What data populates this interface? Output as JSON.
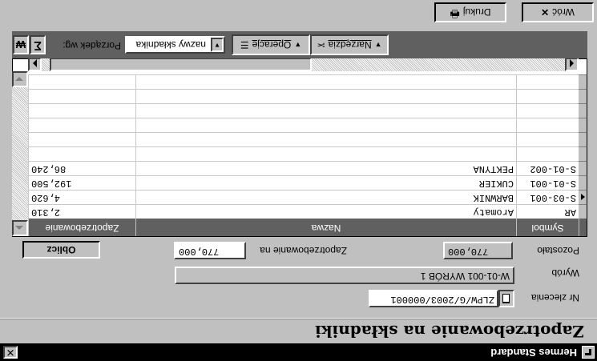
{
  "window": {
    "title": "Hermes Standard",
    "heading": "Zapotrzebowanie na składniki"
  },
  "form": {
    "order_label": "Nr zlecenia",
    "order_value": "ZLPW/G/2003/000001",
    "product_label": "Wyrób",
    "product_value": "W-01-001 WYRÓB 1",
    "remaining_label": "Pozostało",
    "remaining_value": "770,000",
    "demand_label": "Zapotrzebowanie na",
    "demand_value": "770,000",
    "calc_button": "Oblicz"
  },
  "table": {
    "columns": [
      "Symbol",
      "Nazwa",
      "Zapotrzebowanie"
    ],
    "rows": [
      {
        "symbol": "AR",
        "name": "Aromaty",
        "qty": "2,310"
      },
      {
        "symbol": "S-03-001",
        "name": "BARWNIK",
        "qty": "4,620"
      },
      {
        "symbol": "S-01-001",
        "name": "CUKIER",
        "qty": "192,500"
      },
      {
        "symbol": "S-01-002",
        "name": "PEKTYNA",
        "qty": "86,240"
      }
    ]
  },
  "toolbar": {
    "sort_label": "Porządek wg:",
    "sort_value": "nazwy składnika",
    "operations_label": "Operacje",
    "tools_label": "Narzędzia"
  },
  "buttons": {
    "print": "Drukuj",
    "close": "Wróć"
  },
  "icons": [
    "app-icon",
    "close-icon",
    "notebook-icon",
    "filter-icon",
    "sum-icon",
    "printer-icon",
    "x-icon"
  ]
}
